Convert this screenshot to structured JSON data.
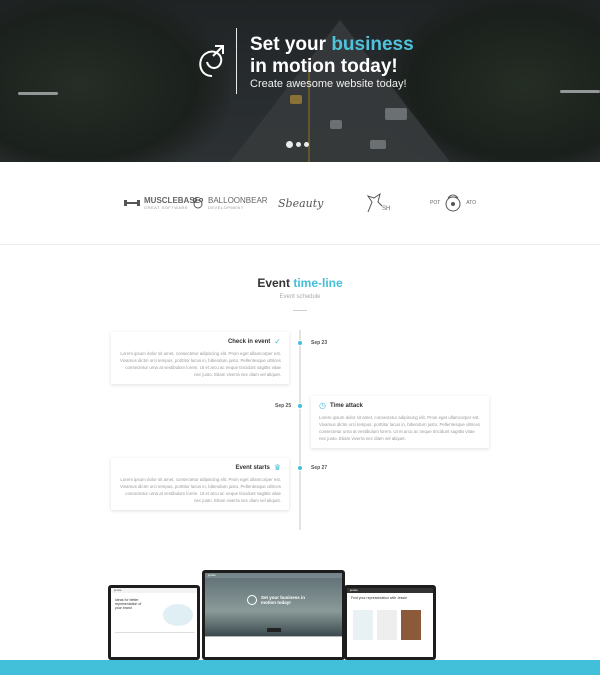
{
  "hero": {
    "title_line1_part1": "Set your ",
    "title_line1_accent": "business",
    "title_line2": "in motion today!",
    "subtitle": "Create awesome website today!",
    "slides": 3,
    "active_slide": 1,
    "logo_icon": "arrow-loop-icon"
  },
  "clients": [
    {
      "name": "MUSCLEBASE",
      "tagline": "GREAT SOFTWARE",
      "icon": "dumbbell-icon"
    },
    {
      "name": "BALLOONBEAR",
      "tagline": "DEVELOPMENT",
      "icon": "bear-icon"
    },
    {
      "name": "Sbeauty",
      "tagline": "",
      "icon": "script-logo"
    },
    {
      "name": "SH",
      "tagline": "",
      "icon": "horse-icon"
    },
    {
      "name": "POT ATO",
      "tagline": "★ ★ ★",
      "icon": "chef-badge-icon"
    }
  ],
  "timeline": {
    "title_plain": "Event ",
    "title_accent": "time-line",
    "subtitle": "Event schedule",
    "events": [
      {
        "title": "Check in event",
        "date": "Sep 23",
        "icon": "check-icon",
        "text": "Lorem ipsum dolor sit amet, consectetur adipiscing elit. Proin eget ullamcorper est. Vivamus dictm orci tempus, porttitor lacus in, bibendum justo. Pellentesque ultrices consectetur urna at vestibulum lorem. Ut et arcu ac neque tincidunt sagittis vitae nec justo. Etiam viverra nec diam vel aliquet."
      },
      {
        "title": "Time attack",
        "date": "Sep 25",
        "icon": "clock-icon",
        "text": "Lorem ipsum dolor sit amet, consectetur adipiscing elit. Proin eget ullamcorper est. Vivamus dictm orci tempus, porttitor lacus in, bibendum justo. Pellentesque ultrices consectetur urna at vestibulum lorem. Ut et arcu ac neque tincidunt sagittis vitae nec justo. Etiam viverra nec diam vel aliquet."
      },
      {
        "title": "Event starts",
        "date": "Sep 27",
        "icon": "crown-icon",
        "text": "Lorem ipsum dolor sit amet, consectetur adipiscing elit. Proin eget ullamcorper est. Vivamus dictm orci tempus, porttitor lacus in, bibendum justo. Pellentesque ultrices consectetur urna at vestibulum lorem. Ut et arcu ac neque tincidunt sagittis vitae nec justo. Etiam viverra nec diam vel aliquet."
      }
    ]
  },
  "devices": {
    "brand": "jessie",
    "center_title": "Set your business in motion today!",
    "left_heading": "Ideas for better representation of your brand",
    "right_heading": "Find your representation with Jessie"
  },
  "colors": {
    "accent": "#43c0d9",
    "hero_bg": "#2e3336"
  }
}
